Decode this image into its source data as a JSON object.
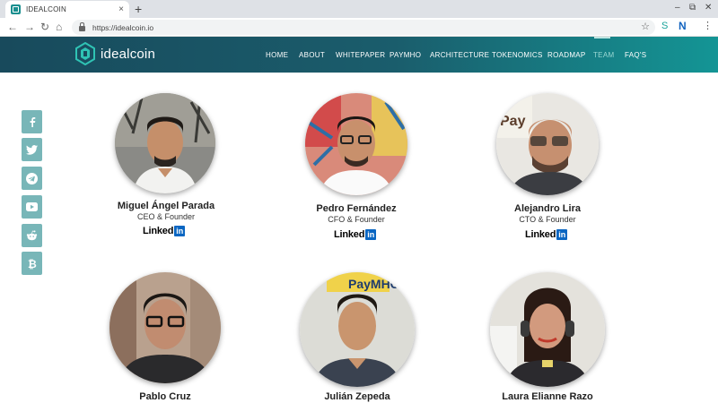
{
  "browser": {
    "tab_title": "IDEALCOIN",
    "tab_close": "×",
    "new_tab": "+",
    "url": "https://idealcoin.io",
    "controls": {
      "minimize": "–",
      "restore": "⧉",
      "close": "✕"
    },
    "nav": {
      "back": "←",
      "forward": "→",
      "reload": "↻",
      "home": "⌂"
    },
    "bookmark_icon": "☆",
    "extension_1": "S",
    "extension_2": "N",
    "menu_icon": "⋮"
  },
  "site": {
    "brand": "idealcoin",
    "nav": [
      {
        "label": "HOME"
      },
      {
        "label": "ABOUT"
      },
      {
        "label": "WHITEPAPER"
      },
      {
        "label": "PAYMHO"
      },
      {
        "label": "ARCHITECTURE"
      },
      {
        "label": "TOKENOMICS"
      },
      {
        "label": "ROADMAP"
      },
      {
        "label": "TEAM",
        "active": true
      },
      {
        "label": "FAQ'S"
      }
    ],
    "social": [
      "facebook-icon",
      "twitter-icon",
      "telegram-icon",
      "youtube-icon",
      "reddit-icon",
      "bitcoin-icon"
    ],
    "linkedin_label": "Linked",
    "linkedin_box": "in"
  },
  "team": [
    {
      "name": "Miguel Ángel Parada",
      "role": "CEO & Founder"
    },
    {
      "name": "Pedro Fernández",
      "role": "CFO & Founder"
    },
    {
      "name": "Alejandro Lira",
      "role": "CTO & Founder"
    },
    {
      "name": "Pablo Cruz",
      "role": ""
    },
    {
      "name": "Julián Zepeda",
      "role": ""
    },
    {
      "name": "Laura Elianne Razo",
      "role": ""
    }
  ],
  "colors": {
    "header_start": "#184a5c",
    "header_end": "#149595",
    "social_bg": "#78b6b8",
    "linkedin_blue": "#0a66c2"
  }
}
